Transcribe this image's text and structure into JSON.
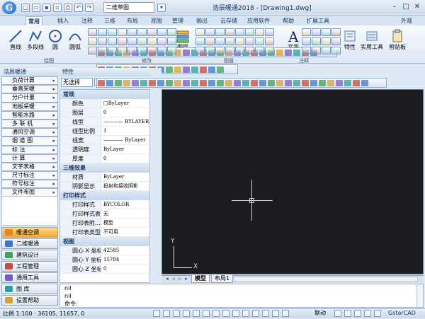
{
  "app": {
    "title": "浩辰暖通2018 - [Drawing1.dwg]",
    "logo": "G",
    "view_combo": "二维草图",
    "outside_label": "外观"
  },
  "ribbon_tabs": [
    "常用",
    "插入",
    "注释",
    "三维",
    "布局",
    "视图",
    "管理",
    "输出",
    "云存储",
    "应用软件",
    "帮助",
    "扩展工具"
  ],
  "active_tab_index": 0,
  "ribbon": {
    "big_buttons": [
      "直线",
      "多段线",
      "圆",
      "圆弧",
      "图层",
      "文字",
      "特性",
      "实用工具",
      "剪贴板"
    ],
    "groups": [
      "绘图",
      "修改",
      "图层",
      "注释"
    ]
  },
  "left_panel": {
    "title": "浩辰暖通",
    "items": [
      "负荷计算",
      "垂直采暖",
      "分户计量",
      "地板采暖",
      "智能水路",
      "多 联 机",
      "通风空调",
      "烟 道 图",
      "标    注",
      "计    算",
      "文字表格",
      "尺寸标注",
      "符号标注",
      "文件布图"
    ],
    "bottom_buttons": [
      "暖通空调",
      "二维暖通",
      "建筑设计",
      "工程管理",
      "通用工具",
      "图    库",
      "设置帮助"
    ],
    "active_bottom_index": 0
  },
  "properties": {
    "title": "特性",
    "selection": "无选择",
    "sections": [
      {
        "name": "常规",
        "rows": [
          [
            "颜色",
            "□ByLayer"
          ],
          [
            "图层",
            "0"
          ],
          [
            "线型",
            "———— BYLAYER"
          ],
          [
            "线型比例",
            "1"
          ],
          [
            "线宽",
            "———— ByLayer"
          ],
          [
            "透明度",
            "ByLayer"
          ],
          [
            "厚度",
            "0"
          ]
        ]
      },
      {
        "name": "三维效果",
        "rows": [
          [
            "材质",
            "ByLayer"
          ],
          [
            "阴影显示",
            "投射和接收阴影"
          ]
        ]
      },
      {
        "name": "打印样式",
        "rows": [
          [
            "打印样式",
            "BYCOLOR"
          ],
          [
            "打印样式表",
            "无"
          ],
          [
            "打印表附...",
            "模型"
          ],
          [
            "打印表类型",
            "不可用"
          ]
        ]
      },
      {
        "name": "视图",
        "rows": [
          [
            "圆心 X 坐标",
            "42585"
          ],
          [
            "圆心 Y 坐标",
            "15784"
          ],
          [
            "圆心 Z 坐标",
            "0"
          ]
        ]
      }
    ]
  },
  "canvas": {
    "ucs_x": "X",
    "ucs_y": "Y"
  },
  "layout_tabs": [
    "模型",
    "布局1"
  ],
  "active_layout_index": 0,
  "command": {
    "lines": [
      "nil",
      "nil"
    ],
    "prompt": "命令:"
  },
  "status": {
    "coords": "比例 1:100 ·  36105, 11657, 0",
    "link": "联动",
    "brand": "GstarCAD"
  },
  "colors": {
    "canvas_bg": "#1b1c20",
    "ribbon_bg": "#dde8f5",
    "active_button": "#f0a830"
  }
}
